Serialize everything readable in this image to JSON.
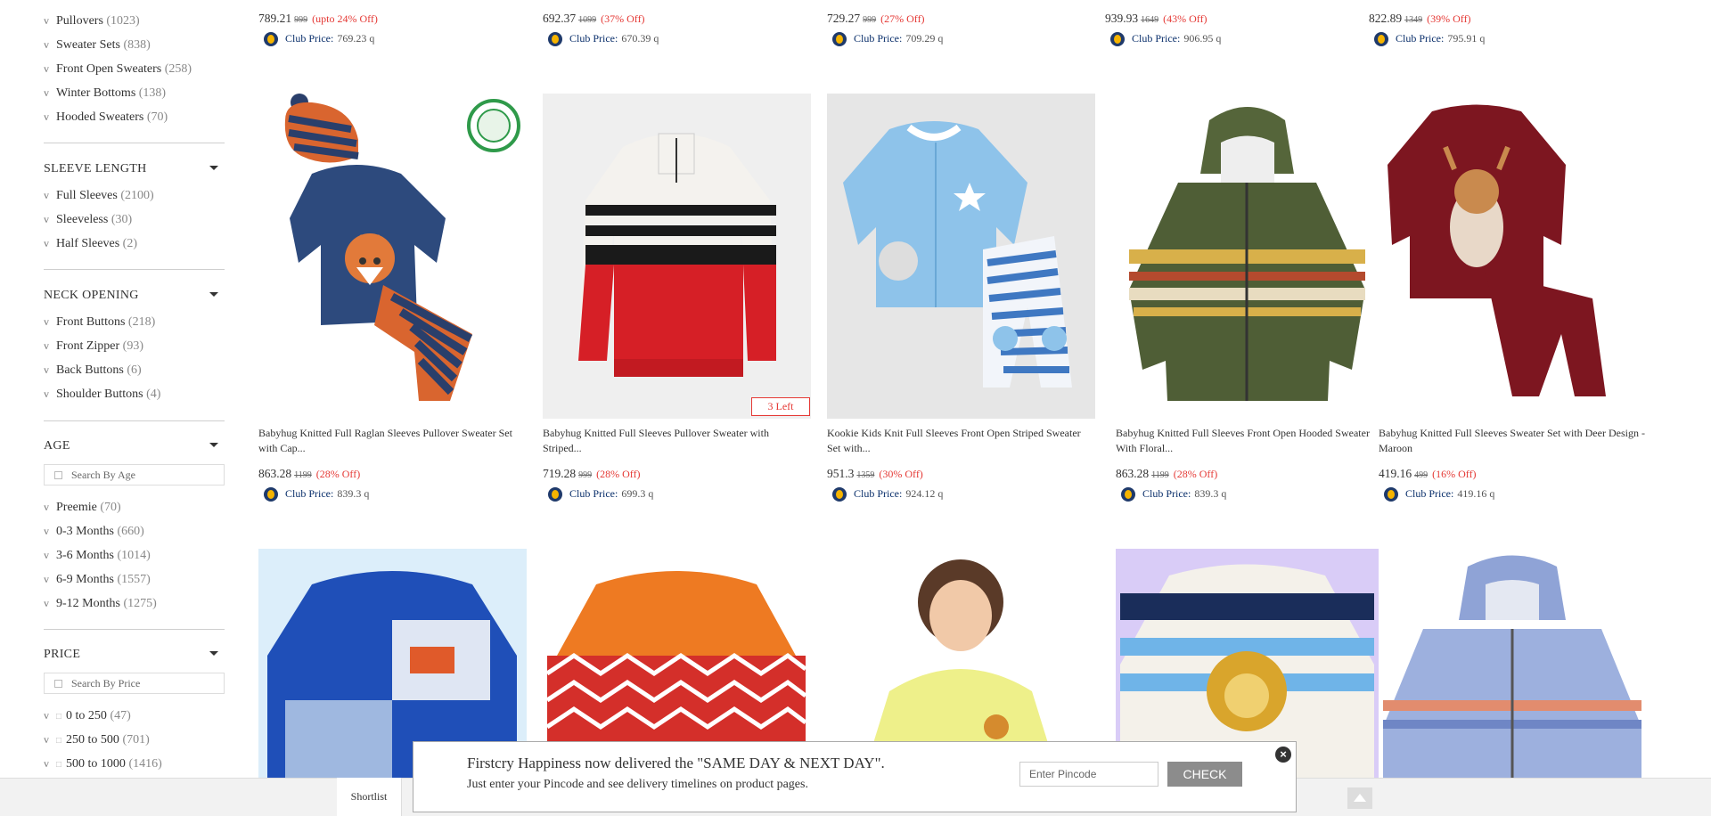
{
  "filters": {
    "top_items": [
      {
        "label": "Pullovers",
        "count": "(1023)"
      },
      {
        "label": "Sweater Sets",
        "count": "(838)"
      },
      {
        "label": "Front Open Sweaters",
        "count": "(258)"
      },
      {
        "label": "Winter Bottoms",
        "count": "(138)"
      },
      {
        "label": "Hooded Sweaters",
        "count": "(70)"
      }
    ],
    "sleeve": {
      "title": "SLEEVE LENGTH",
      "items": [
        {
          "label": "Full Sleeves",
          "count": "(2100)"
        },
        {
          "label": "Sleeveless",
          "count": "(30)"
        },
        {
          "label": "Half Sleeves",
          "count": "(2)"
        }
      ]
    },
    "neck": {
      "title": "NECK OPENING",
      "items": [
        {
          "label": "Front Buttons",
          "count": "(218)"
        },
        {
          "label": "Front Zipper",
          "count": "(93)"
        },
        {
          "label": "Back Buttons",
          "count": "(6)"
        },
        {
          "label": "Shoulder Buttons",
          "count": "(4)"
        }
      ]
    },
    "age": {
      "title": "AGE",
      "search_placeholder": "Search By Age",
      "items": [
        {
          "label": "Preemie",
          "count": "(70)"
        },
        {
          "label": "0-3 Months",
          "count": "(660)"
        },
        {
          "label": "3-6 Months",
          "count": "(1014)"
        },
        {
          "label": "6-9 Months",
          "count": "(1557)"
        },
        {
          "label": "9-12 Months",
          "count": "(1275)"
        }
      ]
    },
    "price": {
      "title": "PRICE",
      "search_placeholder": "Search By Price",
      "items": [
        {
          "label": "0 to 250",
          "count": "(47)"
        },
        {
          "label": "250 to 500",
          "count": "(701)"
        },
        {
          "label": "500 to 1000",
          "count": "(1416)"
        }
      ]
    }
  },
  "club_label": "Club Price:",
  "top_row": [
    {
      "price": "789.21",
      "mrp": "999",
      "off": "(upto 24% Off)",
      "club": "769.23 q"
    },
    {
      "price": "692.37",
      "mrp": "1099",
      "off": "(37% Off)",
      "club": "670.39 q"
    },
    {
      "price": "729.27",
      "mrp": "999",
      "off": "(27% Off)",
      "club": "709.29 q"
    },
    {
      "price": "939.93",
      "mrp": "1649",
      "off": "(43% Off)",
      "club": "906.95 q"
    },
    {
      "price": "822.89",
      "mrp": "1349",
      "off": "(39% Off)",
      "club": "795.91 q"
    }
  ],
  "products": [
    {
      "title": "Babyhug Knitted Full Raglan Sleeves Pullover Sweater Set with Cap...",
      "price": "863.28",
      "mrp": "1199",
      "off": "(28% Off)",
      "club": "839.3 q"
    },
    {
      "title": "Babyhug Knitted Full Sleeves Pullover Sweater with Striped...",
      "price": "719.28",
      "mrp": "999",
      "off": "(28% Off)",
      "club": "699.3 q",
      "badge": "3 Left"
    },
    {
      "title": "Kookie Kids Knit Full Sleeves Front Open Striped Sweater Set with...",
      "price": "951.3",
      "mrp": "1359",
      "off": "(30% Off)",
      "club": "924.12 q"
    },
    {
      "title": "Babyhug Knitted Full Sleeves Front Open Hooded Sweater With Floral...",
      "price": "863.28",
      "mrp": "1199",
      "off": "(28% Off)",
      "club": "839.3 q"
    },
    {
      "title": "Babyhug Knitted Full Sleeves Sweater Set with Deer Design - Maroon",
      "price": "419.16",
      "mrp": "499",
      "off": "(16% Off)",
      "club": "419.16 q"
    }
  ],
  "banner": {
    "line1": "Firstcry Happiness now delivered the \"SAME DAY & NEXT DAY\".",
    "line2": "Just enter your Pincode and see delivery timelines on product pages.",
    "pin_placeholder": "Enter Pincode",
    "check_label": "CHECK",
    "close_glyph": "×"
  },
  "bottom": {
    "shortlist_label": "Shortlist"
  }
}
